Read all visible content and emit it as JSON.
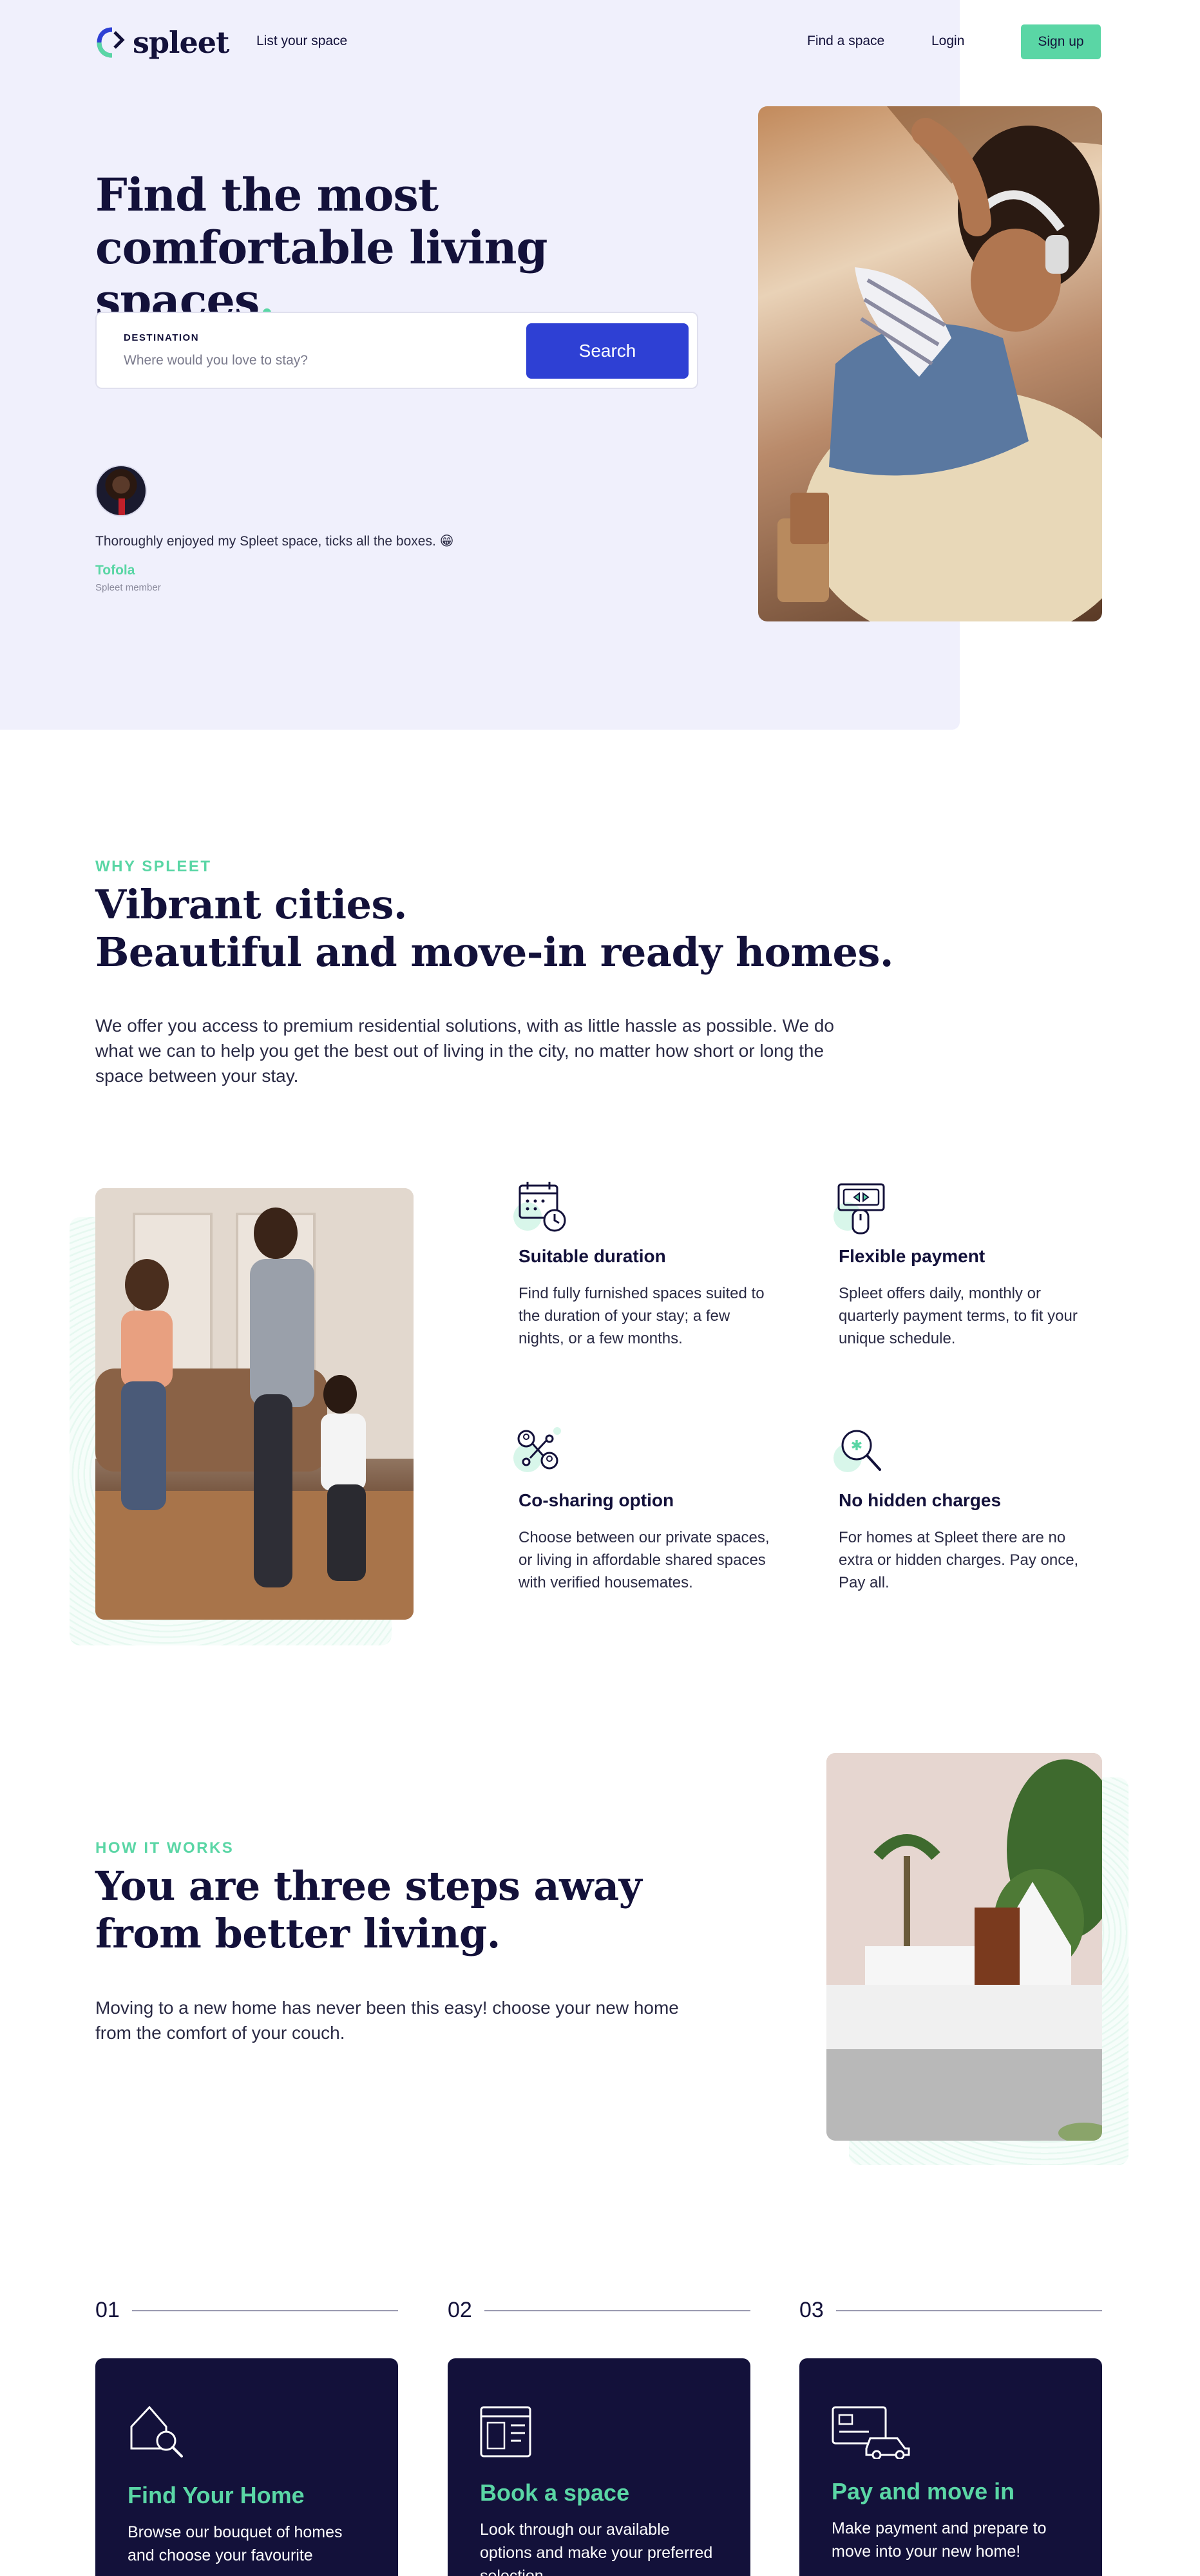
{
  "header": {
    "logo_text": "spleet",
    "list_space": "List your space",
    "find_space": "Find a space",
    "login": "Login",
    "signup": "Sign up"
  },
  "hero": {
    "title_line1": "Find the most",
    "title_line2": "comfortable living spaces",
    "title_dot": ".",
    "search": {
      "label": "DESTINATION",
      "placeholder": "Where would you love to stay?",
      "button": "Search"
    },
    "testimonial": {
      "quote": "Thoroughly enjoyed my Spleet space, ticks all the boxes. 😁",
      "name": "Tofola",
      "role": "Spleet member"
    }
  },
  "why": {
    "eyebrow": "WHY SPLEET",
    "title_line1": "Vibrant cities.",
    "title_line2": "Beautiful and move-in ready homes.",
    "description": "We offer you access to premium residential solutions, with as little hassle as possible. We do what we can to help you get the best out of living in the city, no matter how short or long the space between your stay.",
    "features": [
      {
        "icon": "calendar-clock-icon",
        "title": "Suitable duration",
        "description": "Find fully furnished spaces suited to the duration of your stay; a few nights, or a few months."
      },
      {
        "icon": "payment-icon",
        "title": "Flexible payment",
        "description": "Spleet offers daily, monthly or quarterly payment terms, to fit your unique schedule."
      },
      {
        "icon": "co-sharing-icon",
        "title": "Co-sharing option",
        "description": "Choose between our private spaces, or living in affordable shared spaces with verified housemates."
      },
      {
        "icon": "magnifier-icon",
        "title": "No hidden charges",
        "description": "For homes at Spleet there are no extra or hidden charges. Pay once, Pay all."
      }
    ]
  },
  "how": {
    "eyebrow": "HOW IT WORKS",
    "title_line1": "You are three steps away",
    "title_line2": "from better living.",
    "description": "Moving to a new home has never been this easy! choose your new home from the comfort of your couch."
  },
  "steps": [
    {
      "number": "01",
      "icon": "house-search-icon",
      "title": "Find Your Home",
      "description": "Browse our bouquet of homes and choose your favourite"
    },
    {
      "number": "02",
      "icon": "booking-icon",
      "title": "Book a space",
      "description": "Look through our available options and make your preferred selection"
    },
    {
      "number": "03",
      "icon": "card-car-icon",
      "title": "Pay and move in",
      "description": "Make payment and prepare to move into your new home!"
    }
  ],
  "colors": {
    "navy": "#13113a",
    "accent_green": "#5ad6a5",
    "primary_blue": "#2e40d4",
    "hero_bg": "#f0f0fc"
  }
}
